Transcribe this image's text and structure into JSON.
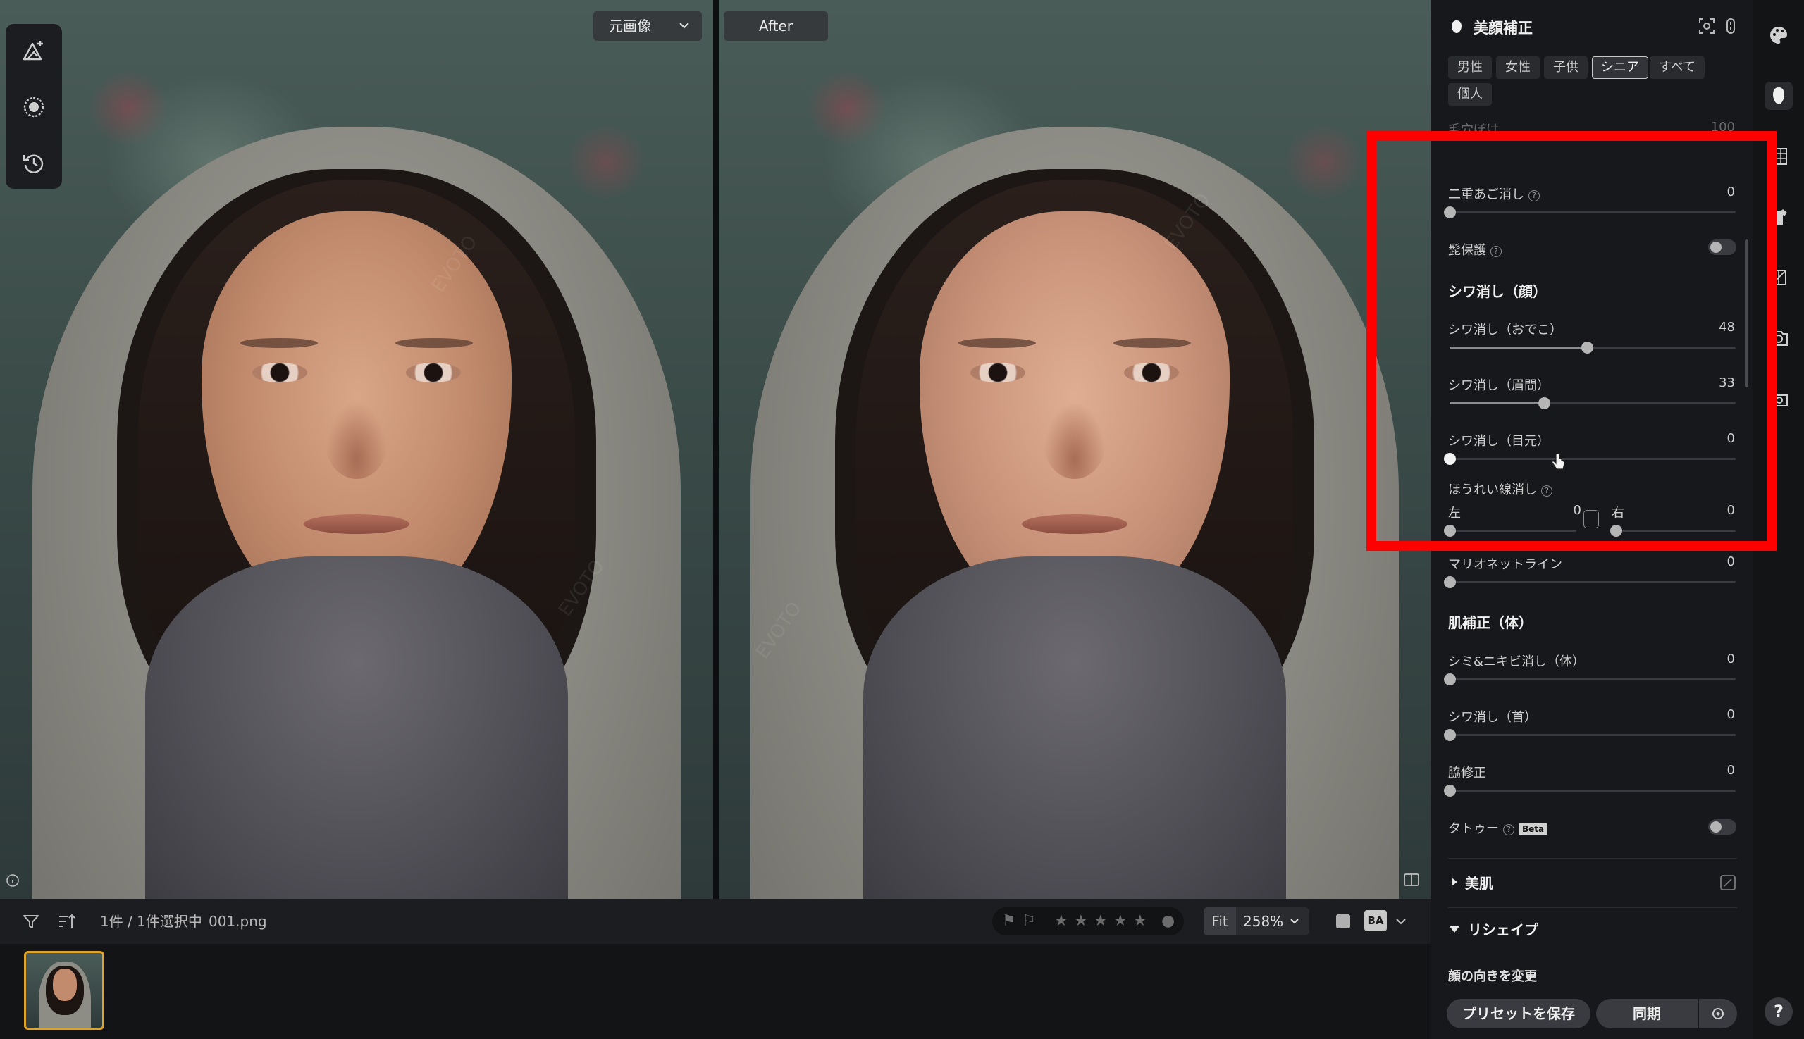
{
  "compare": {
    "dropdown_label": "元画像",
    "after_label": "After"
  },
  "watermark": "EVOTO",
  "bottom_bar": {
    "selection_text": "1件 / 1件選択中",
    "filename": "001.png",
    "zoom_fit": "Fit",
    "zoom_value": "258%",
    "ba_label": "BA"
  },
  "panel": {
    "title": "美顔補正",
    "chips": [
      "男性",
      "女性",
      "子供",
      "シニア",
      "すべて",
      "個人"
    ],
    "active_chip": "シニア",
    "partial_row": {
      "label": "毛穴ぼけ",
      "value": "100"
    },
    "rows": {
      "double_chin": {
        "label": "二重あご消し",
        "value": "0",
        "level": 0
      },
      "beard_protect": {
        "label": "髭保護",
        "on": false
      },
      "wrinkle_section": "シワ消し（顔）",
      "forehead": {
        "label": "シワ消し（おでこ）",
        "value": "48",
        "level": 48
      },
      "glabella": {
        "label": "シワ消し（眉間）",
        "value": "33",
        "level": 33
      },
      "eyes": {
        "label": "シワ消し（目元）",
        "value": "0",
        "level": 0
      },
      "nasolabial": {
        "label": "ほうれい線消し",
        "left_label": "左",
        "left_value": "0",
        "right_label": "右",
        "right_value": "0"
      },
      "marionette": {
        "label": "マリオネットライン",
        "value": "0",
        "level": 0
      },
      "skin_body_section": "肌補正（体）",
      "blemish_body": {
        "label": "シミ&ニキビ消し（体）",
        "value": "0",
        "level": 0
      },
      "neck_wrinkle": {
        "label": "シワ消し（首）",
        "value": "0",
        "level": 0
      },
      "armpit": {
        "label": "脇修正",
        "value": "0",
        "level": 0
      },
      "tattoo": {
        "label": "タトゥー",
        "beta": "Beta",
        "on": false
      }
    },
    "beauty_skin": "美肌",
    "reshape": "リシェイプ",
    "face_direction": "顔の向きを変更",
    "save_preset": "プリセットを保存",
    "sync": "同期"
  },
  "help_label": "?"
}
